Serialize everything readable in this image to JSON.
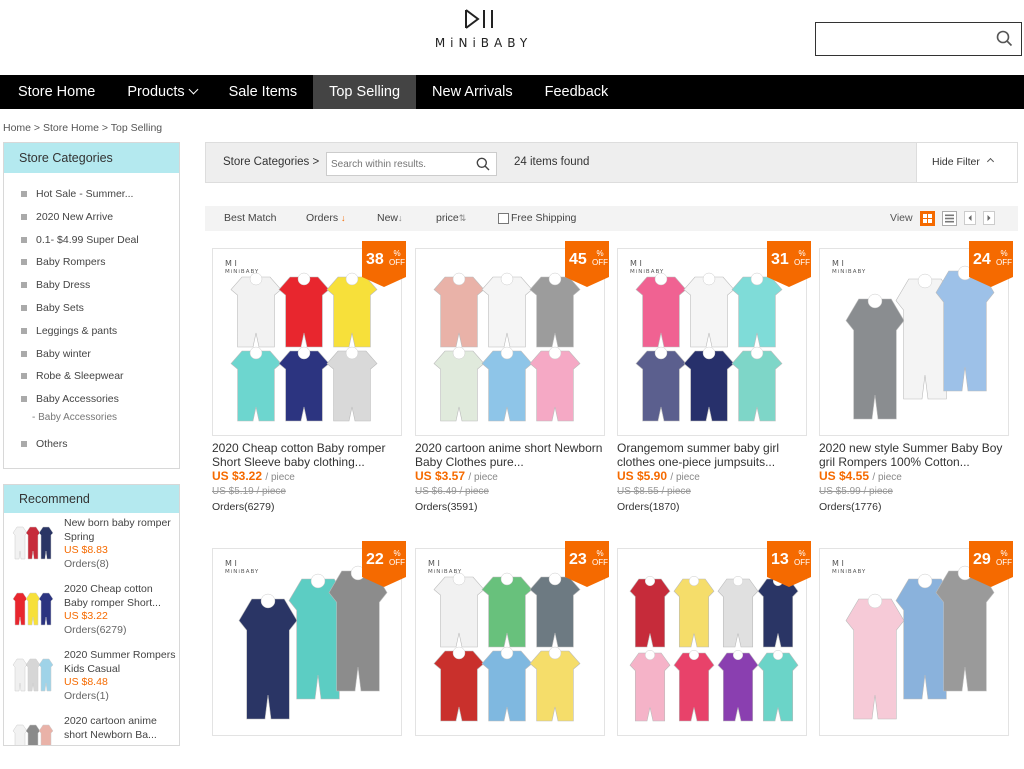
{
  "header": {
    "logo_text": "MiNiBABY",
    "search_placeholder": ""
  },
  "nav": [
    {
      "label": "Store Home"
    },
    {
      "label": "Products"
    },
    {
      "label": "Sale Items"
    },
    {
      "label": "Top Selling"
    },
    {
      "label": "New Arrivals"
    },
    {
      "label": "Feedback"
    }
  ],
  "breadcrumb": "Home > Store Home > Top Selling",
  "sidebar": {
    "categories_title": "Store Categories",
    "categories": [
      "Hot Sale - Summer...",
      "2020 New Arrive",
      "0.1- $4.99 Super Deal",
      "Baby Rompers",
      "Baby Dress",
      "Baby Sets",
      "Leggings & pants",
      "Baby winter",
      "Robe & Sleepwear",
      "Baby Accessories"
    ],
    "sub_category": "Baby Accessories",
    "others": "Others",
    "recommend_title": "Recommend",
    "recommend": [
      {
        "title": "New born baby romper Spring",
        "price": "US $8.83",
        "orders": "Orders(8)"
      },
      {
        "title": "2020 Cheap cotton Baby romper Short...",
        "price": "US $3.22",
        "orders": "Orders(6279)"
      },
      {
        "title": "2020 Summer Rompers Kids Casual",
        "price": "US $8.48",
        "orders": "Orders(1)"
      },
      {
        "title": "2020 cartoon anime short Newborn Ba...",
        "price": "",
        "orders": ""
      }
    ]
  },
  "filter": {
    "label": "Store Categories >",
    "search_placeholder": "Search within results.",
    "found": "24 items found",
    "hide_filter": "Hide Filter"
  },
  "sort": {
    "best_match": "Best Match",
    "orders": "Orders",
    "new": "New",
    "price": "price",
    "free_shipping": "Free Shipping",
    "view": "View"
  },
  "badge_off": "OFF",
  "products": [
    {
      "discount": "38",
      "title": "2020 Cheap cotton Baby romper Short Sleeve baby clothing...",
      "price": "US $3.22",
      "unit": "/ piece",
      "old_price": "US $5.19 / piece",
      "orders": "Orders(6279)",
      "colors": [
        "#f2f2f2",
        "#e8262e",
        "#f7e03a",
        "#6dd6cf",
        "#2c3480",
        "#d9d9d9"
      ]
    },
    {
      "discount": "45",
      "title": "2020 cartoon anime short Newborn Baby Clothes pure...",
      "price": "US $3.57",
      "unit": "/ piece",
      "old_price": "US $6.49 / piece",
      "orders": "Orders(3591)",
      "colors": [
        "#e9b2a8",
        "#f5f5f5",
        "#9c9c9c",
        "#e0eadc",
        "#8ec5e8",
        "#f5a9c5"
      ]
    },
    {
      "discount": "31",
      "title": "Orangemom summer baby girl clothes one-piece jumpsuits...",
      "price": "US $5.90",
      "unit": "/ piece",
      "old_price": "US $8.55 / piece",
      "orders": "Orders(1870)",
      "colors": [
        "#f06292",
        "#f5f5f5",
        "#7fdcd8",
        "#5b5f8e",
        "#27306b",
        "#7ed6c8"
      ]
    },
    {
      "discount": "24",
      "title": "2020 new style Summer Baby Boy gril Rompers 100% Cotton...",
      "price": "US $4.55",
      "unit": "/ piece",
      "old_price": "US $5.99 / piece",
      "orders": "Orders(1776)",
      "colors": [
        "#8a8d90",
        "#f4f4f4",
        "#9dc1e8"
      ]
    },
    {
      "discount": "22",
      "title": "",
      "price": "",
      "unit": "",
      "old_price": "",
      "orders": "",
      "colors": [
        "#2a3565",
        "#5ccdc3",
        "#8c8c8c"
      ]
    },
    {
      "discount": "23",
      "title": "",
      "price": "",
      "unit": "",
      "old_price": "",
      "orders": "",
      "colors": [
        "#f1f1f1",
        "#68c17c",
        "#6d7a82",
        "#c9302c",
        "#7fb8e0",
        "#f5dd6a"
      ]
    },
    {
      "discount": "13",
      "title": "",
      "price": "",
      "unit": "",
      "old_price": "",
      "orders": "",
      "colors": [
        "#c62b3a",
        "#f5dd6a",
        "#e0e0e0",
        "#2a3565",
        "#f5b3c8",
        "#e8426a",
        "#8a3fb0",
        "#6bd4c8"
      ]
    },
    {
      "discount": "29",
      "title": "",
      "price": "",
      "unit": "",
      "old_price": "",
      "orders": "",
      "colors": [
        "#f6cad7",
        "#8ab2dc",
        "#9a9a9a"
      ]
    }
  ],
  "accent": "#f56a00",
  "icons": [
    "logo-mark",
    "search-icon",
    "chevron-down-icon",
    "chevron-up-icon",
    "grid-view-icon",
    "list-view-icon",
    "prev-page-icon",
    "next-page-icon"
  ]
}
